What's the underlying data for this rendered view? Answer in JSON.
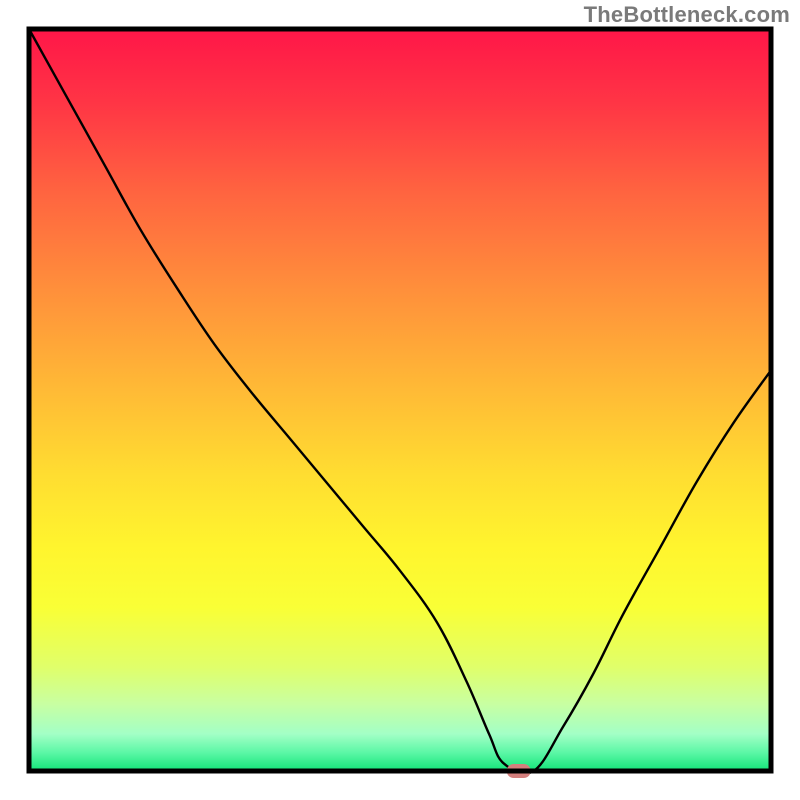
{
  "watermark": "TheBottleneck.com",
  "chart_data": {
    "type": "line",
    "title": "",
    "xlabel": "",
    "ylabel": "",
    "xlim": [
      0,
      100
    ],
    "ylim": [
      0,
      100
    ],
    "x": [
      0,
      5,
      10,
      15,
      20,
      25,
      30,
      35,
      40,
      45,
      50,
      55,
      59,
      62,
      64,
      68,
      72,
      76,
      80,
      85,
      90,
      95,
      100
    ],
    "values": [
      100,
      91,
      82,
      73,
      65,
      57.5,
      51,
      45,
      39,
      33,
      27,
      20,
      12,
      5,
      1,
      0,
      6,
      13,
      21,
      30,
      39,
      47,
      54
    ],
    "marker": {
      "x": 66,
      "y": 0,
      "color": "#d47f7d",
      "rx": 12,
      "ry": 7
    },
    "gradient_stops": [
      {
        "offset": 0.0,
        "color": "#ff1648"
      },
      {
        "offset": 0.1,
        "color": "#ff3545"
      },
      {
        "offset": 0.22,
        "color": "#ff6440"
      },
      {
        "offset": 0.35,
        "color": "#ff8f3b"
      },
      {
        "offset": 0.48,
        "color": "#ffb836"
      },
      {
        "offset": 0.6,
        "color": "#ffdd31"
      },
      {
        "offset": 0.7,
        "color": "#fff52e"
      },
      {
        "offset": 0.78,
        "color": "#f9ff36"
      },
      {
        "offset": 0.86,
        "color": "#e0ff6a"
      },
      {
        "offset": 0.91,
        "color": "#c8ffa2"
      },
      {
        "offset": 0.95,
        "color": "#a3ffc6"
      },
      {
        "offset": 0.975,
        "color": "#5cf7a6"
      },
      {
        "offset": 1.0,
        "color": "#12e578"
      }
    ],
    "grid": false,
    "legend": false
  }
}
